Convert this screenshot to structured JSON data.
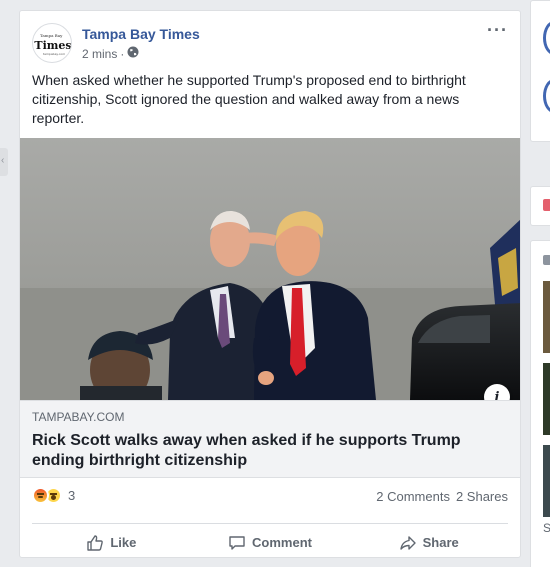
{
  "post": {
    "page_name": "Tampa Bay Times",
    "time": "2 mins",
    "privacy_icon": "globe-icon",
    "logo_text": "Times",
    "text": "When asked whether he supported Trump's proposed end to birthright citizenship, Scott ignored the question and walked away from a news reporter."
  },
  "link": {
    "domain": "TAMPABAY.COM",
    "title": "Rick Scott walks away when asked if he supports Trump ending birthright citizenship"
  },
  "stats": {
    "reaction_count": "3",
    "comments": "2 Comments",
    "shares": "2 Shares",
    "reactions": [
      "angry",
      "wow"
    ]
  },
  "actions": {
    "like": "Like",
    "comment": "Comment",
    "share": "Share"
  },
  "right_rail": {
    "letter": "S"
  },
  "colors": {
    "link_blue": "#365899",
    "background": "#e9ebee",
    "secondary_text": "#606770"
  }
}
